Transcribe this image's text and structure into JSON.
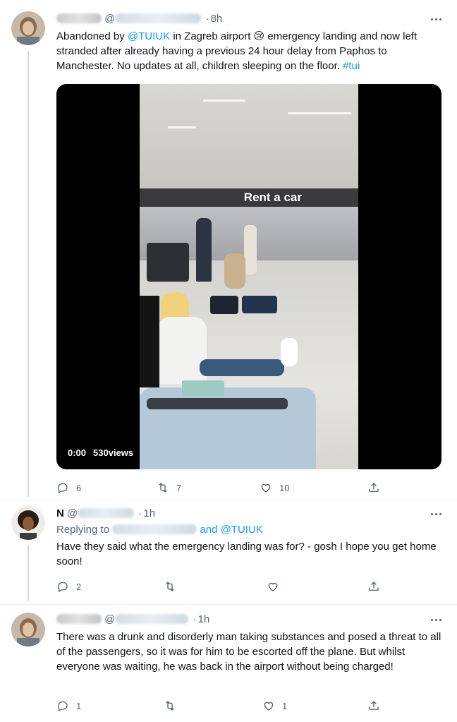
{
  "colors": {
    "link": "#1d9bf0",
    "text": "#0f1419",
    "muted": "#536471",
    "thread_line": "#cfd9de"
  },
  "tweets": [
    {
      "at": "@",
      "time": "8h",
      "text_parts": [
        "Abandoned by ",
        "@TUIUK",
        " in Zagreb airport 😢 emergency landing and now left stranded after already having a previous 24 hour delay from Paphos to Manchester. No updates at all, children sleeping on the floor. ",
        "#tui"
      ],
      "video": {
        "time": "0:00",
        "views": "530views",
        "sign": "Rent a car"
      },
      "actions": {
        "reply": "6",
        "retweet": "7",
        "like": "10"
      }
    },
    {
      "name": "N",
      "at": "@",
      "time": "1h",
      "replying_prefix": "Replying to ",
      "replying_suffix": "and @TUIUK",
      "text": "Have they said what the emergency landing was for? - gosh I hope you get home soon!",
      "actions": {
        "reply": "2",
        "retweet": "",
        "like": ""
      }
    },
    {
      "at": "@",
      "time": "1h",
      "text": "There was a drunk and disorderly man taking substances and posed a threat to all of the passengers, so it was for him to be escorted off the plane. But whilst everyone was waiting, he was back in the airport without being charged!",
      "actions": {
        "reply": "1",
        "retweet": "",
        "like": "1"
      }
    }
  ],
  "icons": [
    "reply-icon",
    "retweet-icon",
    "like-icon",
    "share-icon",
    "more-icon"
  ]
}
